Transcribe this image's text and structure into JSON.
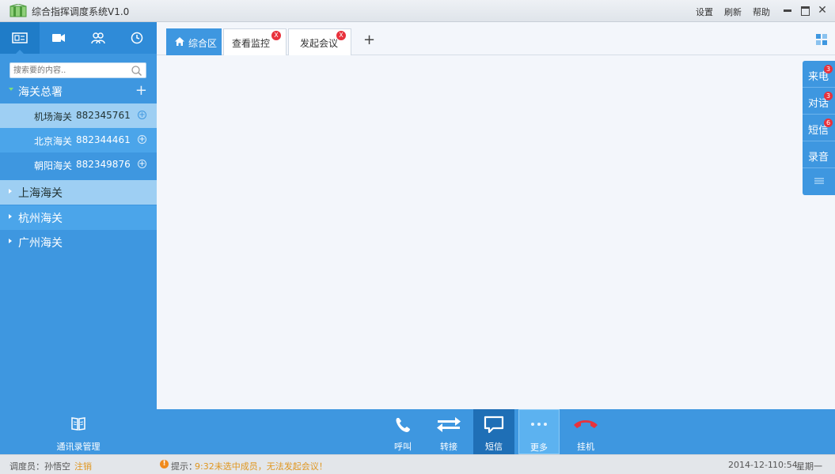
{
  "app": {
    "title": "综合指挥调度系统V1.0",
    "menu": [
      "设置",
      "刷新",
      "帮助"
    ]
  },
  "sidebar": {
    "tabs": [
      "contacts-card-icon",
      "video-icon",
      "group-icon",
      "clock-icon"
    ],
    "search_placeholder": "搜索要的内容..",
    "root_group": "海关总署",
    "items": [
      {
        "name": "机场海关",
        "number": "882345761"
      },
      {
        "name": "北京海关",
        "number": "882344461"
      },
      {
        "name": "朝阳海关",
        "number": "882349876"
      }
    ],
    "groups": [
      "上海海关",
      "杭州海关",
      "广州海关"
    ]
  },
  "tabs": {
    "home": "综合区",
    "tab2": "查看监控",
    "tab3": "发起会议",
    "close": "X",
    "add": "+"
  },
  "right_panel": [
    {
      "label": "来电",
      "badge": "3"
    },
    {
      "label": "对话",
      "badge": "3"
    },
    {
      "label": "短信",
      "badge": "6"
    },
    {
      "label": "录音",
      "badge": ""
    }
  ],
  "toolbar": {
    "contacts": "通讯录管理",
    "call": "呼叫",
    "transfer": "转接",
    "sms": "短信",
    "more": "更多",
    "hangup": "挂机"
  },
  "status": {
    "operator": "调度员：孙悟空",
    "logout": "注销",
    "warn_glyph": "!",
    "hint_label": "提示：",
    "hint": "9:32未选中成员，无法发起会议！",
    "date": "2014-12-1",
    "time": "10:54",
    "weekday": "星期一"
  },
  "colors": {
    "primary": "#3e97e0",
    "selected_row": "#9ecff3",
    "badge": "#e8323c",
    "hangup": "#e8323c",
    "warning": "#e0961f"
  }
}
